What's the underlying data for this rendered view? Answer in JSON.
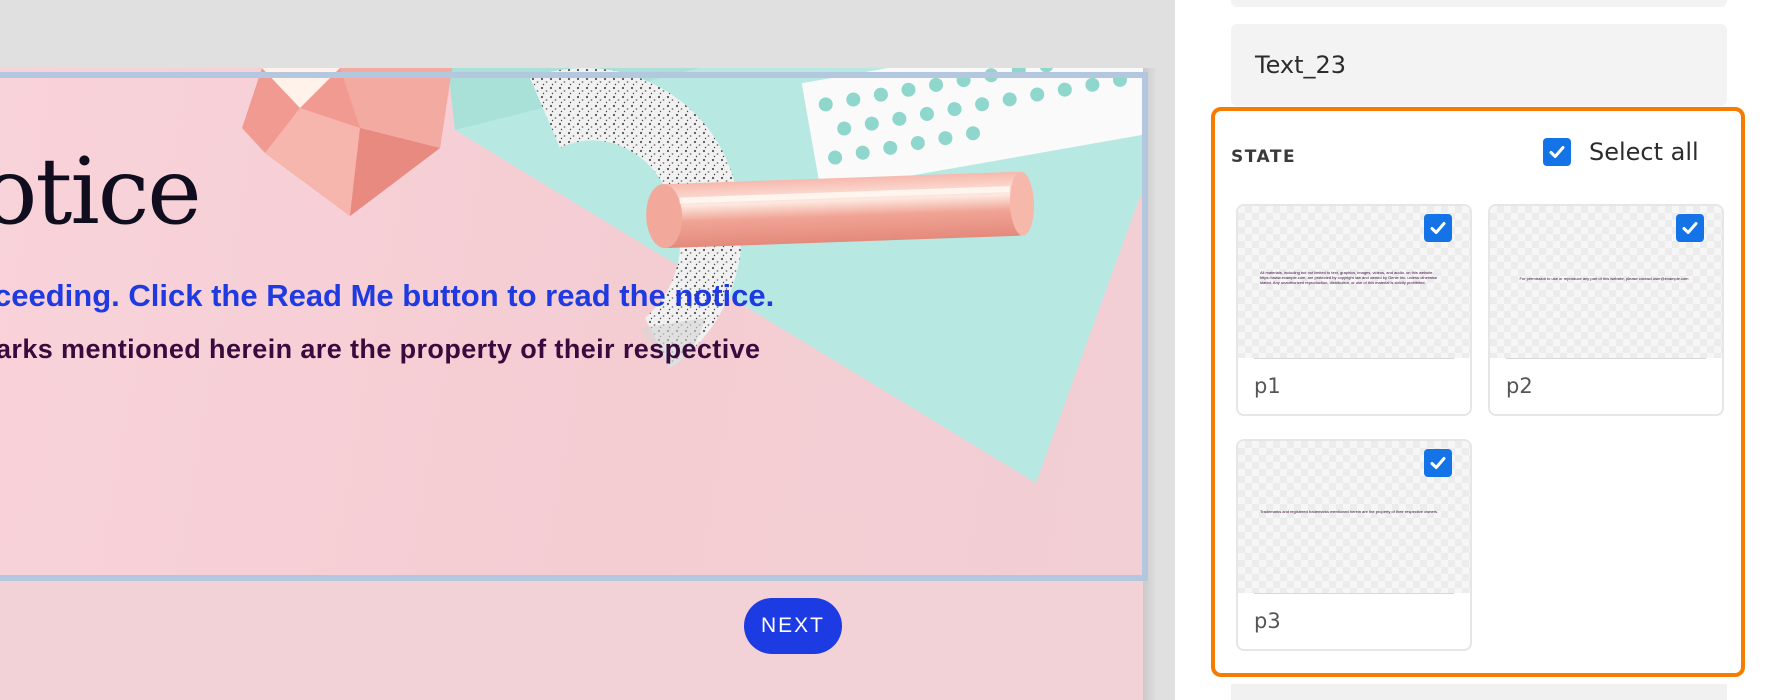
{
  "canvas": {
    "title_fragment": "otice",
    "line1_fragment": "ceeding. Click the Read Me button to read the notice.",
    "line2_fragment": "arks mentioned herein are the property of their respective",
    "next_button_label": "NEXT"
  },
  "panel": {
    "element_name": "Text_23",
    "state_heading": "STATE",
    "select_all_label": "Select all",
    "select_all_checked": true,
    "states": [
      {
        "name": "p1",
        "checked": true,
        "preview_text": "All materials, including but not limited to text, graphics, images, videos, and audio, on this website, https://www.example.com, are protected by copyright law and owned by Genie Inc. unless otherwise stated. Any unauthorized reproduction, distribution, or use of this material is strictly prohibited."
      },
      {
        "name": "p2",
        "checked": true,
        "preview_text": "For permission to use or reproduce any part of this website, please contact user@example.com"
      },
      {
        "name": "p3",
        "checked": true,
        "preview_text": "Trademarks and registered trademarks mentioned herein are the property of their respective owners."
      }
    ]
  },
  "colors": {
    "accent_orange": "#f57c00",
    "checkbox_blue": "#1473e6",
    "next_button_blue": "#1d3be3",
    "slide_pink": "#f3d2d7",
    "mint": "#b7e9e2"
  },
  "icons": {
    "checkbox": "checkmark-icon"
  }
}
